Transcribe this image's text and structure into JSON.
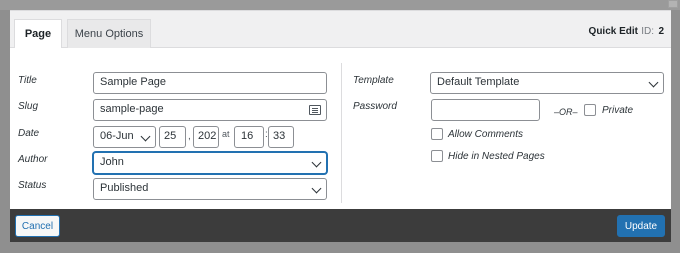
{
  "tabs": [
    {
      "label": "Page"
    },
    {
      "label": "Menu Options"
    }
  ],
  "header": {
    "quick_edit": "Quick Edit",
    "id_label": "ID:",
    "id_value": "2"
  },
  "left": {
    "title": {
      "label": "Title",
      "value": "Sample Page"
    },
    "slug": {
      "label": "Slug",
      "value": "sample-page"
    },
    "date": {
      "label": "Date",
      "month": "06-Jun",
      "day": "25",
      "sep1": ",",
      "year": "202",
      "at": "at",
      "hour": "16",
      "sep2": ":",
      "minute": "33"
    },
    "author": {
      "label": "Author",
      "value": "John"
    },
    "status": {
      "label": "Status",
      "value": "Published"
    }
  },
  "right": {
    "template": {
      "label": "Template",
      "value": "Default Template"
    },
    "password": {
      "label": "Password",
      "value": "",
      "or_text": "–OR–",
      "private_label": "Private"
    },
    "allow_comments": {
      "label": "Allow Comments",
      "checked": false
    },
    "hide_nested": {
      "label": "Hide in Nested Pages",
      "checked": false
    }
  },
  "footer": {
    "cancel": "Cancel",
    "update": "Update"
  },
  "colors": {
    "accent": "#2271b1",
    "footer_bg": "#3c3c3c"
  }
}
